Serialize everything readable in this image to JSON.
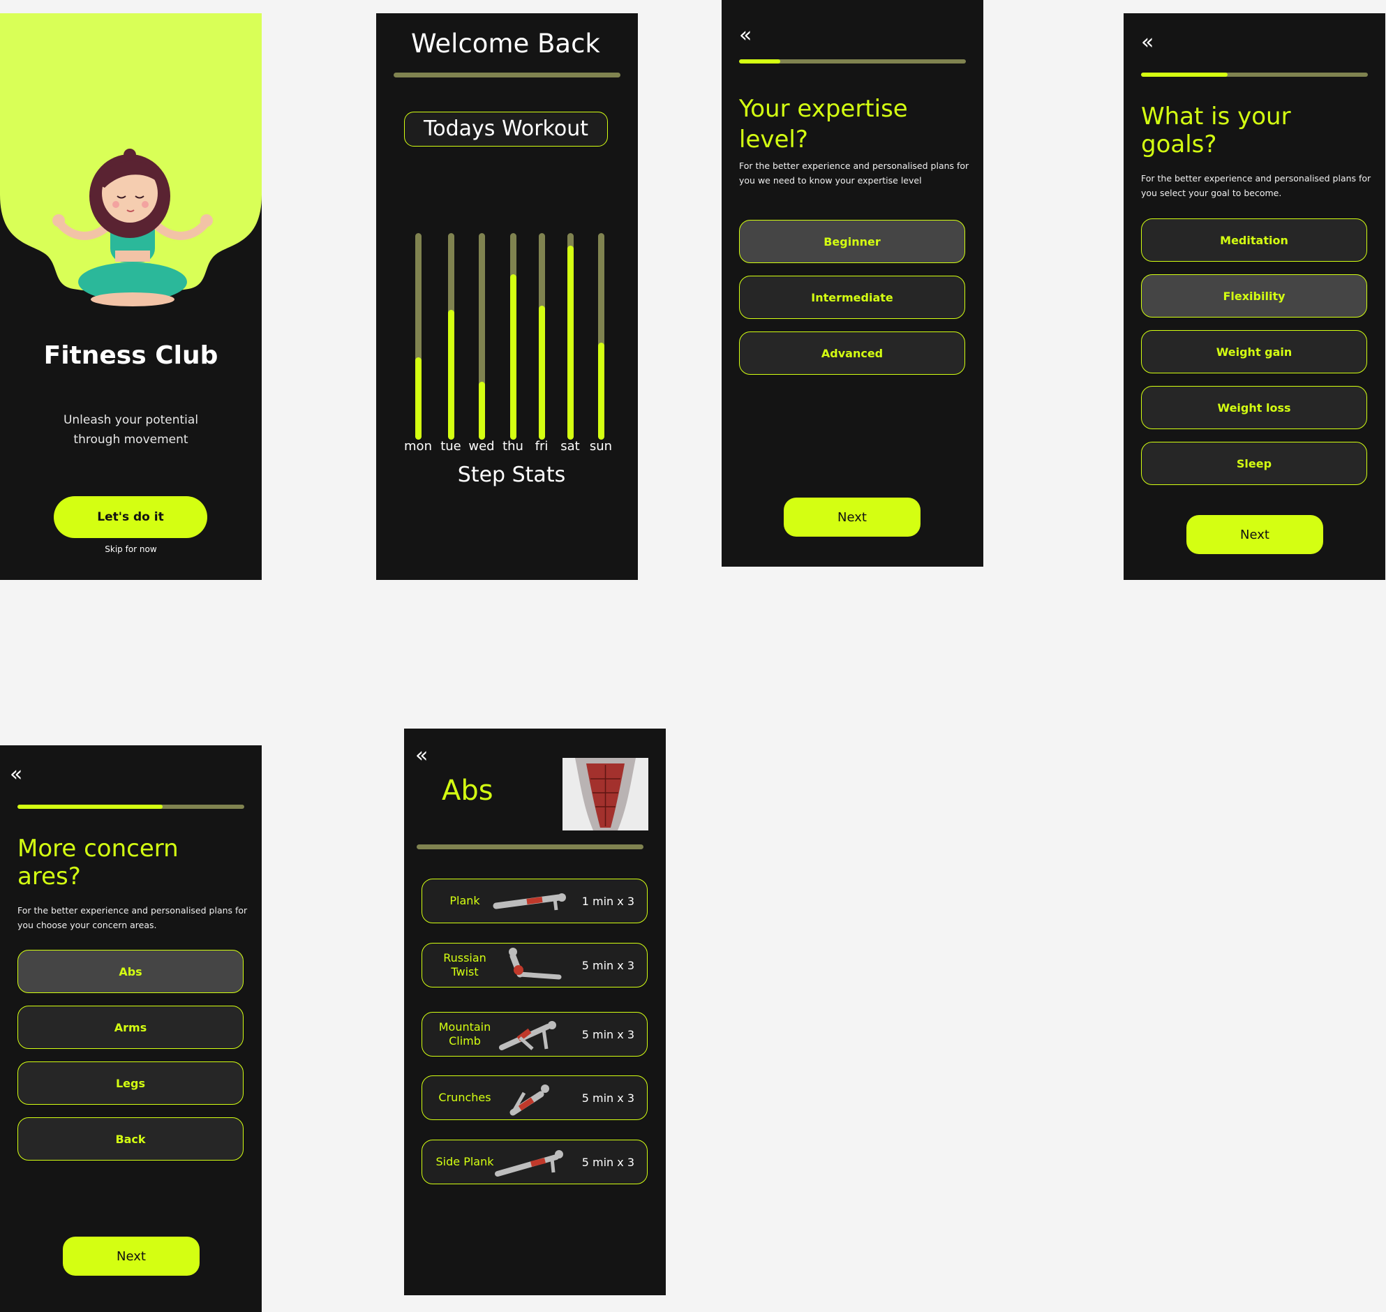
{
  "colors": {
    "accent": "#d4ff12",
    "background": "#141414",
    "muted_bar": "#808350",
    "card": "#262626"
  },
  "splash": {
    "title": "Fitness Club",
    "tagline": "Unleash your potential through movement",
    "cta": "Let's do it",
    "skip": "Skip for now",
    "illustration": "meditating-woman-illustration"
  },
  "welcome": {
    "heading": "Welcome Back",
    "workout_label": "Todays Workout",
    "stats_title": "Step Stats",
    "chart_data": {
      "type": "bar",
      "title": "Step Stats",
      "categories": [
        "mon",
        "tue",
        "wed",
        "thu",
        "fri",
        "sat",
        "sun"
      ],
      "values": [
        0.4,
        0.63,
        0.28,
        0.8,
        0.65,
        0.94,
        0.47
      ],
      "ylim": [
        0,
        1
      ],
      "grid": false
    }
  },
  "expertise": {
    "back_icon": "double-chevron-left-icon",
    "progress": 0.18,
    "title": "Your expertise level?",
    "description": "For the better experience and personalised plans for you we need to know your expertise level",
    "options": [
      {
        "label": "Beginner",
        "selected": true
      },
      {
        "label": "Intermediate",
        "selected": false
      },
      {
        "label": "Advanced",
        "selected": false
      }
    ],
    "next": "Next"
  },
  "goals": {
    "back_icon": "double-chevron-left-icon",
    "progress": 0.38,
    "title": "What is your goals?",
    "description": "For the better experience and personalised plans for you select your goal to become.",
    "options": [
      {
        "label": "Meditation",
        "selected": false
      },
      {
        "label": "Flexibility",
        "selected": true
      },
      {
        "label": "Weight gain",
        "selected": false
      },
      {
        "label": "Weight loss",
        "selected": false
      },
      {
        "label": "Sleep",
        "selected": false
      }
    ],
    "next": "Next"
  },
  "concern": {
    "back_icon": "double-chevron-left-icon",
    "progress": 0.64,
    "title": "More concern ares?",
    "description": "For the better experience and personalised plans for you choose your concern areas.",
    "options": [
      {
        "label": "Abs",
        "selected": true
      },
      {
        "label": "Arms",
        "selected": false
      },
      {
        "label": "Legs",
        "selected": false
      },
      {
        "label": "Back",
        "selected": false
      }
    ],
    "next": "Next"
  },
  "abs": {
    "back_icon": "double-chevron-left-icon",
    "title": "Abs",
    "image": "abdominal-muscles-image",
    "exercises": [
      {
        "name": "Plank",
        "duration": "1 min x 3"
      },
      {
        "name": "Russian Twist",
        "duration": "5 min x 3"
      },
      {
        "name": "Mountain Climb",
        "duration": "5 min x 3"
      },
      {
        "name": "Crunches",
        "duration": "5 min x 3"
      },
      {
        "name": "Side Plank",
        "duration": "5 min x 3"
      }
    ]
  }
}
